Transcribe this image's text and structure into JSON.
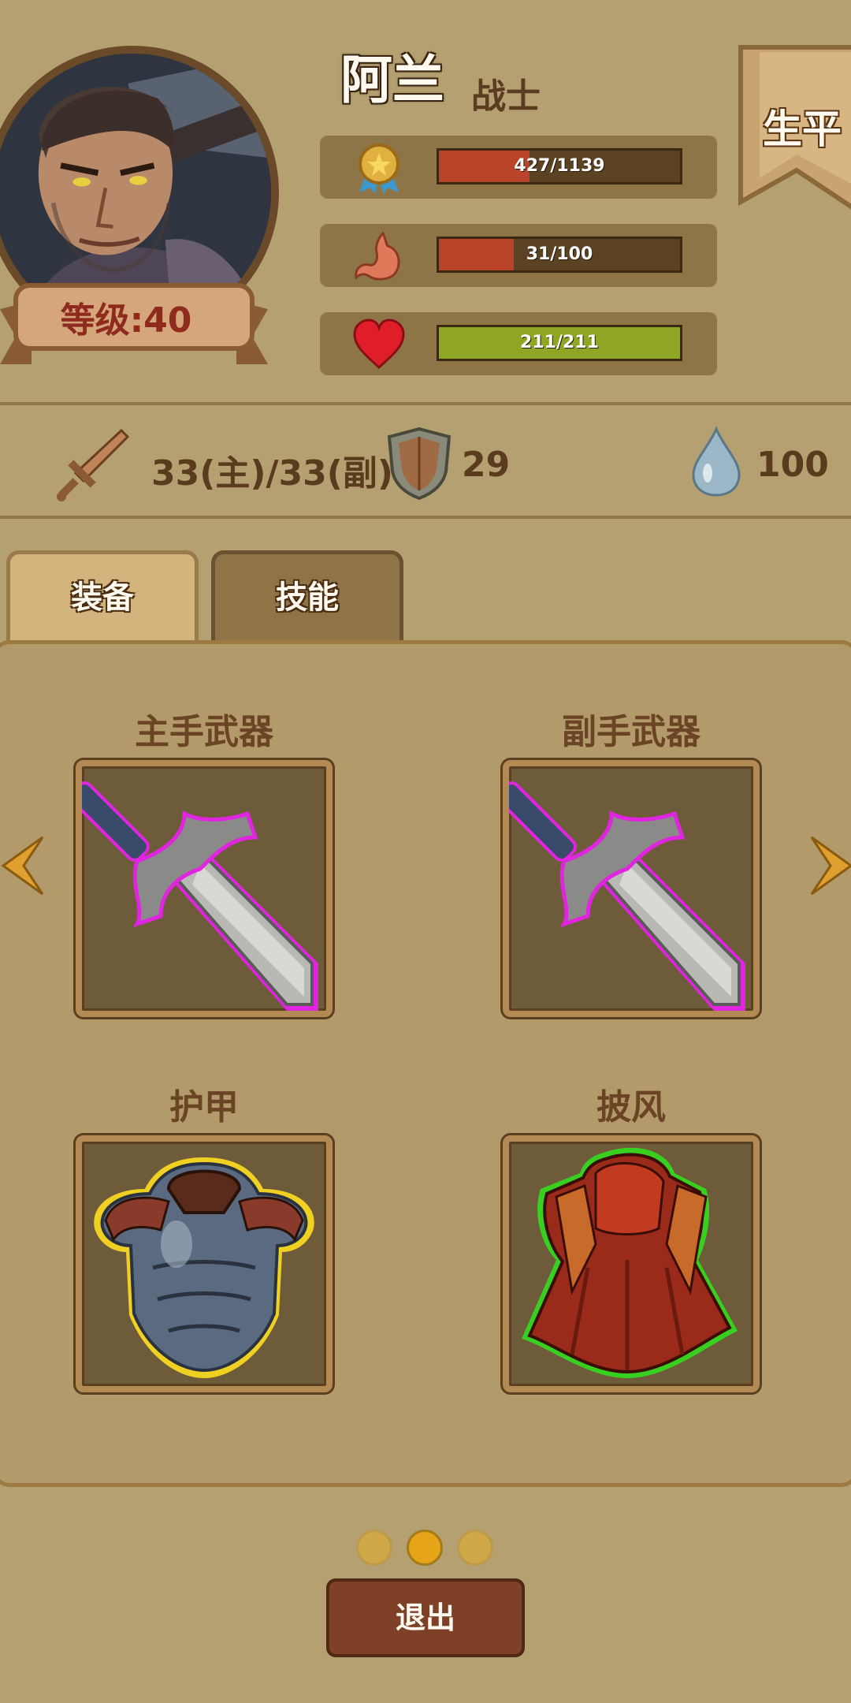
{
  "hero": {
    "name": "阿兰",
    "class": "战士",
    "level_label": "等级:40",
    "biography_label": "生平"
  },
  "stats": [
    {
      "icon": "medal-icon",
      "text": "427/1139",
      "current": 427,
      "max": 1139,
      "color": "#b9442a"
    },
    {
      "icon": "stomach-icon",
      "text": "31/100",
      "current": 31,
      "max": 100,
      "color": "#b9442a"
    },
    {
      "icon": "heart-icon",
      "text": "211/211",
      "current": 211,
      "max": 211,
      "color": "#8ea624"
    }
  ],
  "attributes": {
    "attack": "33(主)/33(副)",
    "defense": "29",
    "water": "100",
    "attack_icon": "sword-icon",
    "defense_icon": "shield-icon",
    "water_icon": "water-drop-icon"
  },
  "tabs": [
    {
      "label": "装备",
      "active": true
    },
    {
      "label": "技能",
      "active": false
    }
  ],
  "equipment": {
    "main_weapon_label": "主手武器",
    "off_weapon_label": "副手武器",
    "armor_label": "护甲",
    "cloak_label": "披风",
    "main_weapon_icon": "sword-item-icon",
    "off_weapon_icon": "sword-item-icon",
    "armor_icon": "chest-armor-icon",
    "cloak_icon": "cloak-icon",
    "rarity_colors": {
      "weapon": "#e024e0",
      "armor": "#f0d020",
      "cloak": "#38d020"
    }
  },
  "pagination": {
    "pages": 3,
    "current": 2
  },
  "exit_label": "退出",
  "colors": {
    "background": "#b4a070",
    "accent_red": "#b9442a",
    "accent_green": "#8ea624"
  }
}
